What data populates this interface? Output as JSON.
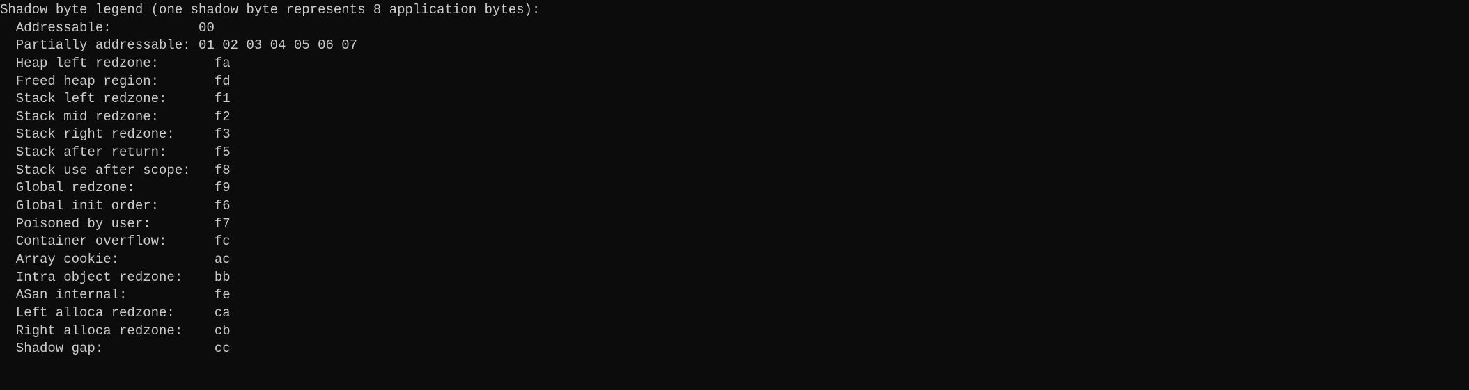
{
  "legend": {
    "header": "Shadow byte legend (one shadow byte represents 8 application bytes):",
    "entries": [
      {
        "label": "Addressable:           ",
        "value": "00"
      },
      {
        "label": "Partially addressable: ",
        "value": "01 02 03 04 05 06 07"
      },
      {
        "label": "Heap left redzone:       ",
        "value": "fa"
      },
      {
        "label": "Freed heap region:       ",
        "value": "fd"
      },
      {
        "label": "Stack left redzone:      ",
        "value": "f1"
      },
      {
        "label": "Stack mid redzone:       ",
        "value": "f2"
      },
      {
        "label": "Stack right redzone:     ",
        "value": "f3"
      },
      {
        "label": "Stack after return:      ",
        "value": "f5"
      },
      {
        "label": "Stack use after scope:   ",
        "value": "f8"
      },
      {
        "label": "Global redzone:          ",
        "value": "f9"
      },
      {
        "label": "Global init order:       ",
        "value": "f6"
      },
      {
        "label": "Poisoned by user:        ",
        "value": "f7"
      },
      {
        "label": "Container overflow:      ",
        "value": "fc"
      },
      {
        "label": "Array cookie:            ",
        "value": "ac"
      },
      {
        "label": "Intra object redzone:    ",
        "value": "bb"
      },
      {
        "label": "ASan internal:           ",
        "value": "fe"
      },
      {
        "label": "Left alloca redzone:     ",
        "value": "ca"
      },
      {
        "label": "Right alloca redzone:    ",
        "value": "cb"
      },
      {
        "label": "Shadow gap:              ",
        "value": "cc"
      }
    ]
  }
}
